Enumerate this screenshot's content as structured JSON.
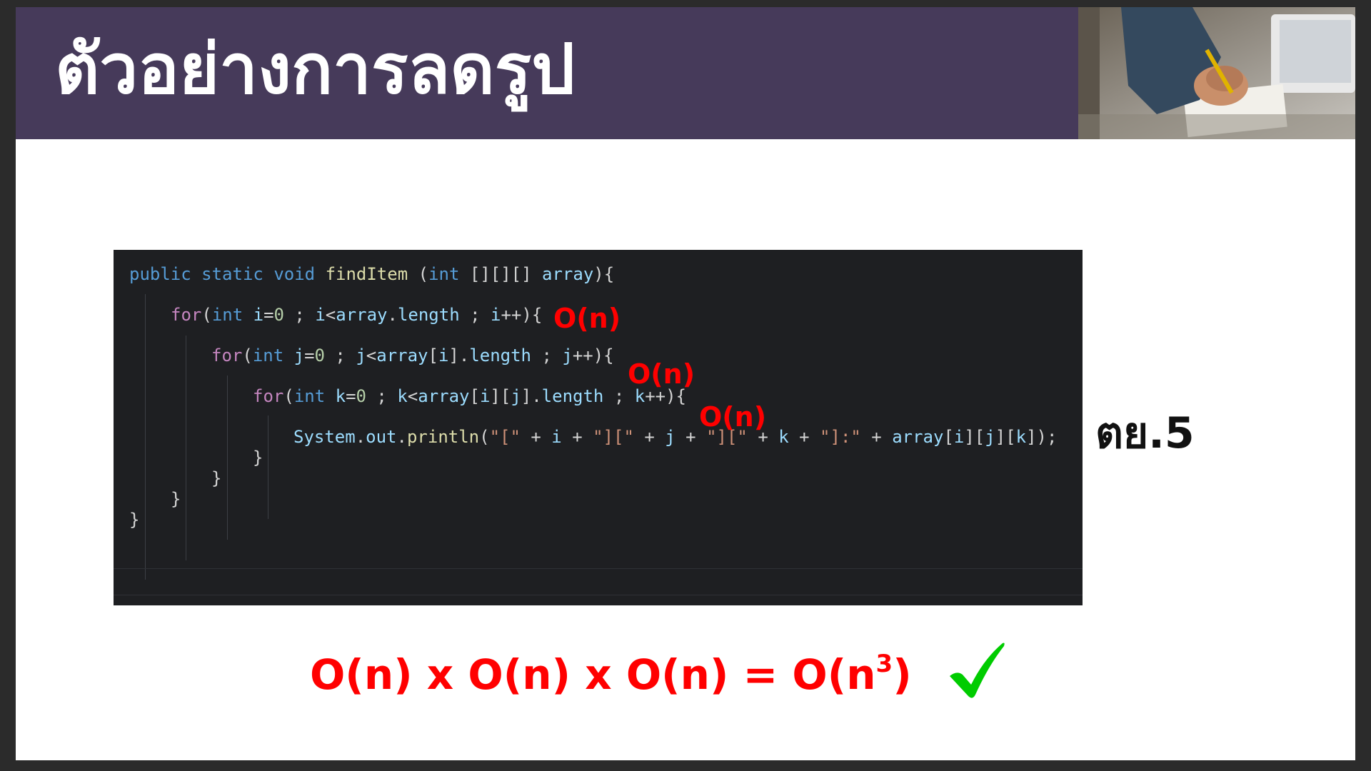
{
  "slide": {
    "title": "ตัวอย่างการลดรูป",
    "side_label": "ตย.5",
    "photo": "person-writing-at-desk-photo"
  },
  "code": {
    "lines": [
      [
        "public",
        " ",
        "static",
        " ",
        "void",
        " ",
        "findItem",
        " (",
        "int",
        " [][][] ",
        "array",
        "){"
      ],
      [
        "for",
        "(",
        "int",
        " ",
        "i",
        "=",
        "0",
        " ; ",
        "i",
        "<",
        "array",
        ".",
        "length",
        " ; ",
        "i",
        "++){"
      ],
      [
        "for",
        "(",
        "int",
        " ",
        "j",
        "=",
        "0",
        " ; ",
        "j",
        "<",
        "array",
        "[",
        "i",
        "].",
        "length",
        " ; ",
        "j",
        "++){"
      ],
      [
        "for",
        "(",
        "int",
        " ",
        "k",
        "=",
        "0",
        " ; ",
        "k",
        "<",
        "array",
        "[",
        "i",
        "][",
        "j",
        "].",
        "length",
        " ; ",
        "k",
        "++){"
      ],
      [
        "System",
        ".",
        "out",
        ".",
        "println",
        "(",
        "\"[\"",
        " + ",
        "i",
        " + ",
        "\"][\"",
        " + ",
        "j",
        " + ",
        "\"][\"",
        " + ",
        "k",
        " + ",
        "\"]:\"",
        " + ",
        "array",
        "[",
        "i",
        "][",
        "j",
        "][",
        "k",
        "]);"
      ],
      [
        "}"
      ],
      [
        "}"
      ],
      [
        "}"
      ],
      [
        "}"
      ]
    ]
  },
  "annotations": {
    "loop_i": "O(n)",
    "loop_j": "O(n)",
    "loop_k": "O(n)"
  },
  "formula": {
    "lhs": "O(n) x O(n) x O(n)",
    "eq": " = ",
    "rhs_pre": "O(n",
    "rhs_sup": "3",
    "rhs_post": ")",
    "check_icon": "green-checkmark"
  },
  "colors": {
    "title_bar": "#463a5a",
    "annotation": "#ff0000",
    "check": "#00cc00",
    "code_bg": "#1e1f22"
  }
}
